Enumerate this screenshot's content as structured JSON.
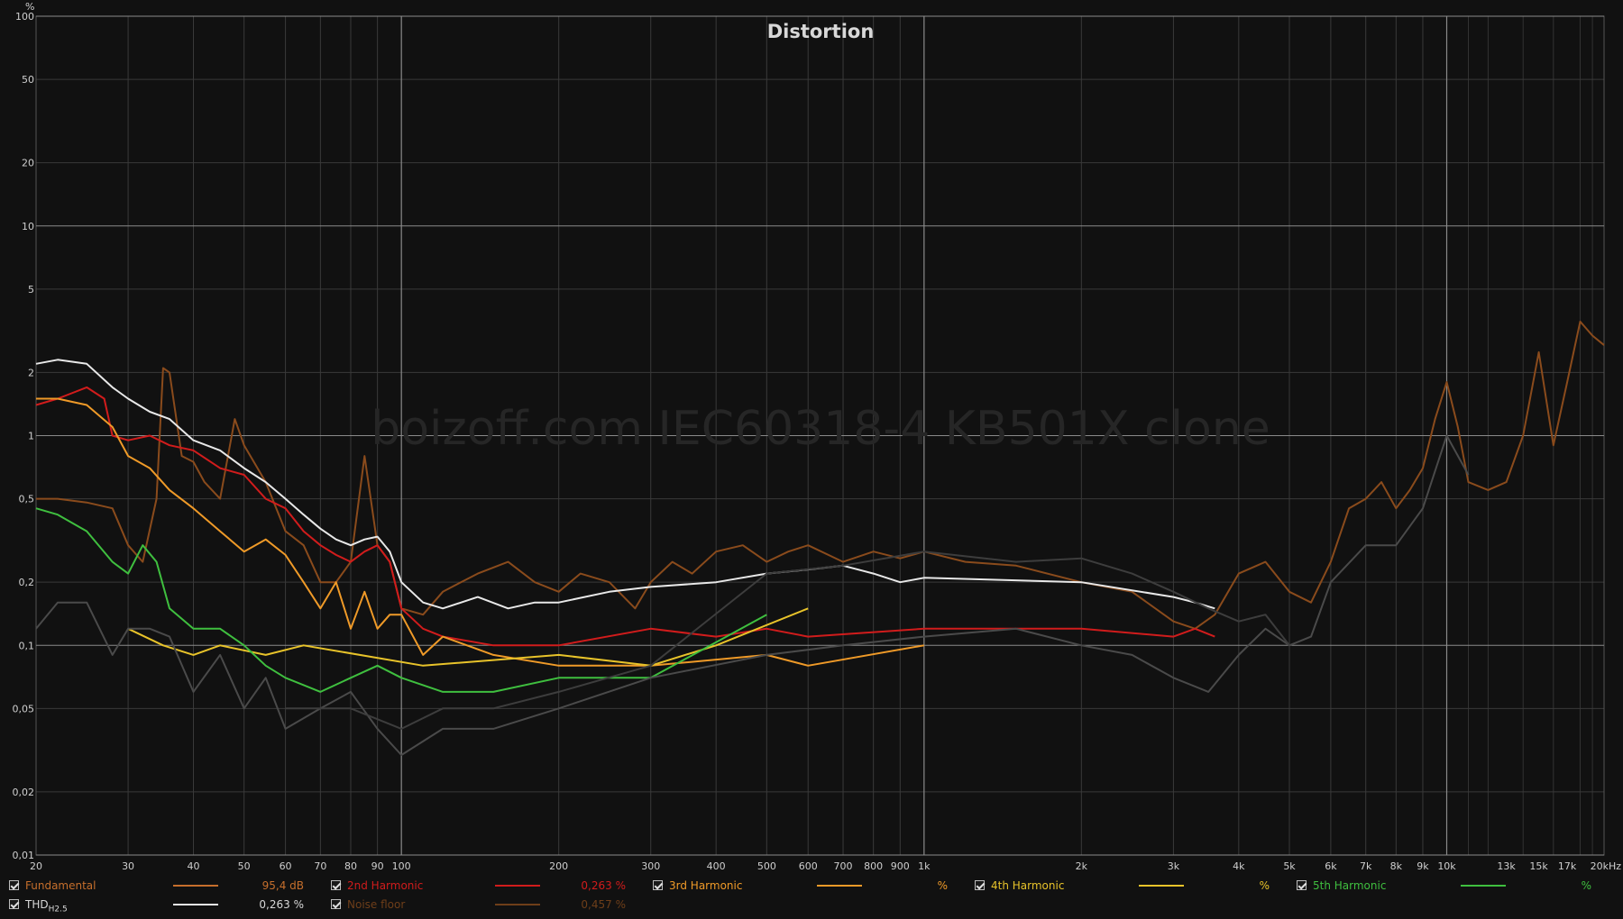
{
  "chart_data": {
    "type": "line",
    "title": "Distortion",
    "watermark": "boizoff.com IEC60318-4 KB501X clone",
    "y_unit": "%",
    "x_unit": "kHz",
    "xscale": "log",
    "yscale": "log",
    "xlim": [
      20,
      20000
    ],
    "ylim": [
      0.01,
      100
    ],
    "y_ticks": [
      100,
      50,
      20,
      10,
      5,
      2,
      1,
      0.5,
      0.2,
      0.1,
      0.05,
      0.02,
      0.01
    ],
    "y_tick_labels": [
      "100",
      "50",
      "20",
      "10",
      "5",
      "2",
      "1",
      "0,5",
      "0,2",
      "0,1",
      "0,05",
      "0,02",
      "0,01"
    ],
    "x_ticks": [
      20,
      30,
      40,
      50,
      60,
      70,
      80,
      90,
      100,
      200,
      300,
      400,
      500,
      600,
      700,
      800,
      900,
      1000,
      2000,
      3000,
      4000,
      5000,
      6000,
      7000,
      8000,
      9000,
      10000,
      13000,
      15000,
      17000,
      20000
    ],
    "x_tick_labels": [
      "20",
      "30",
      "40",
      "50",
      "60",
      "70",
      "80",
      "90",
      "100",
      "200",
      "300",
      "400",
      "500",
      "600",
      "700",
      "800",
      "900",
      "1k",
      "2k",
      "3k",
      "4k",
      "5k",
      "6k",
      "7k",
      "8k",
      "9k",
      "10k",
      "13k",
      "15k",
      "17k",
      "20kHz"
    ],
    "grid": true,
    "series": [
      {
        "key": "noise",
        "color": "#8a4b1c",
        "x": [
          20,
          22,
          25,
          28,
          30,
          32,
          34,
          35,
          36,
          38,
          40,
          42,
          45,
          48,
          50,
          55,
          60,
          65,
          70,
          75,
          80,
          85,
          90,
          95,
          100,
          110,
          120,
          130,
          140,
          160,
          180,
          200,
          220,
          250,
          280,
          300,
          330,
          360,
          400,
          450,
          500,
          550,
          600,
          700,
          800,
          900,
          1000,
          1200,
          1500,
          2000,
          2500,
          3000,
          3300,
          3600,
          4000,
          4500,
          5000,
          5500,
          6000,
          6500,
          7000,
          7500,
          8000,
          8500,
          9000,
          9500,
          10000,
          10500,
          11000,
          12000,
          13000,
          14000,
          15000,
          16000,
          17000,
          18000,
          19000,
          20000
        ],
        "y": [
          0.5,
          0.5,
          0.48,
          0.45,
          0.3,
          0.25,
          0.5,
          2.1,
          2.0,
          0.8,
          0.75,
          0.6,
          0.5,
          1.2,
          0.9,
          0.6,
          0.35,
          0.3,
          0.2,
          0.2,
          0.25,
          0.8,
          0.3,
          0.25,
          0.15,
          0.14,
          0.18,
          0.2,
          0.22,
          0.25,
          0.2,
          0.18,
          0.22,
          0.2,
          0.15,
          0.2,
          0.25,
          0.22,
          0.28,
          0.3,
          0.25,
          0.28,
          0.3,
          0.25,
          0.28,
          0.26,
          0.28,
          0.25,
          0.24,
          0.2,
          0.18,
          0.13,
          0.12,
          0.14,
          0.22,
          0.25,
          0.18,
          0.16,
          0.25,
          0.45,
          0.5,
          0.6,
          0.45,
          0.55,
          0.7,
          1.2,
          1.8,
          1.1,
          0.6,
          0.55,
          0.6,
          1.0,
          2.5,
          0.9,
          1.8,
          3.5,
          3.0,
          2.7
        ]
      },
      {
        "key": "fund",
        "color": "#c66f2c",
        "x": [],
        "y": []
      },
      {
        "key": "thd",
        "color": "#e8e8e8",
        "x": [
          20,
          22,
          25,
          28,
          30,
          33,
          36,
          40,
          45,
          50,
          55,
          60,
          65,
          70,
          75,
          80,
          85,
          90,
          95,
          100,
          110,
          120,
          140,
          160,
          180,
          200,
          250,
          300,
          400,
          500,
          600,
          700,
          800,
          900,
          1000,
          2000,
          3000,
          3300,
          3600
        ],
        "y": [
          2.2,
          2.3,
          2.2,
          1.7,
          1.5,
          1.3,
          1.2,
          0.95,
          0.85,
          0.7,
          0.6,
          0.5,
          0.42,
          0.36,
          0.32,
          0.3,
          0.32,
          0.33,
          0.28,
          0.2,
          0.16,
          0.15,
          0.17,
          0.15,
          0.16,
          0.16,
          0.18,
          0.19,
          0.2,
          0.22,
          0.23,
          0.24,
          0.22,
          0.2,
          0.21,
          0.2,
          0.17,
          0.16,
          0.15
        ]
      },
      {
        "key": "h2",
        "color": "#d11c1c",
        "x": [
          20,
          22,
          25,
          27,
          28,
          30,
          33,
          36,
          40,
          45,
          50,
          55,
          60,
          65,
          70,
          75,
          80,
          85,
          90,
          95,
          100,
          110,
          120,
          150,
          200,
          300,
          400,
          500,
          600,
          1000,
          2000,
          3000,
          3300,
          3600
        ],
        "y": [
          1.4,
          1.5,
          1.7,
          1.5,
          1.0,
          0.95,
          1.0,
          0.9,
          0.85,
          0.7,
          0.65,
          0.5,
          0.45,
          0.35,
          0.3,
          0.27,
          0.25,
          0.28,
          0.3,
          0.25,
          0.15,
          0.12,
          0.11,
          0.1,
          0.1,
          0.12,
          0.11,
          0.12,
          0.11,
          0.12,
          0.12,
          0.11,
          0.12,
          0.11
        ]
      },
      {
        "key": "h3",
        "color": "#ef9a28",
        "x": [
          20,
          22,
          25,
          28,
          30,
          33,
          36,
          40,
          45,
          50,
          55,
          60,
          65,
          70,
          75,
          80,
          85,
          90,
          95,
          100,
          110,
          120,
          150,
          200,
          300,
          500,
          600,
          1000
        ],
        "y": [
          1.5,
          1.5,
          1.4,
          1.1,
          0.8,
          0.7,
          0.55,
          0.45,
          0.35,
          0.28,
          0.32,
          0.27,
          0.2,
          0.15,
          0.2,
          0.12,
          0.18,
          0.12,
          0.14,
          0.14,
          0.09,
          0.11,
          0.09,
          0.08,
          0.08,
          0.09,
          0.08,
          0.1
        ]
      },
      {
        "key": "h4",
        "color": "#e8c32a",
        "x": [
          30,
          35,
          40,
          45,
          55,
          65,
          110,
          200,
          300,
          400,
          600
        ],
        "y": [
          0.12,
          0.1,
          0.09,
          0.1,
          0.09,
          0.1,
          0.08,
          0.09,
          0.08,
          0.1,
          0.15
        ]
      },
      {
        "key": "h5",
        "color": "#3fbf3f",
        "x": [
          20,
          22,
          25,
          28,
          30,
          32,
          34,
          36,
          40,
          45,
          50,
          55,
          60,
          70,
          80,
          90,
          100,
          120,
          150,
          200,
          300,
          500
        ],
        "y": [
          0.45,
          0.42,
          0.35,
          0.25,
          0.22,
          0.3,
          0.25,
          0.15,
          0.12,
          0.12,
          0.1,
          0.08,
          0.07,
          0.06,
          0.07,
          0.08,
          0.07,
          0.06,
          0.06,
          0.07,
          0.07,
          0.14
        ]
      },
      {
        "key": "grey1",
        "color": "#4a4a4a",
        "x": [
          20,
          22,
          25,
          28,
          30,
          33,
          36,
          40,
          45,
          50,
          55,
          60,
          70,
          80,
          90,
          100,
          120,
          150,
          200,
          300,
          500,
          700,
          1000,
          1500,
          2000,
          2500,
          3000,
          3500,
          4000,
          4500,
          5000,
          5500,
          6000,
          7000,
          8000,
          9000,
          10000,
          11000
        ],
        "y": [
          0.12,
          0.16,
          0.16,
          0.09,
          0.12,
          0.12,
          0.11,
          0.06,
          0.09,
          0.05,
          0.07,
          0.04,
          0.05,
          0.06,
          0.04,
          0.03,
          0.04,
          0.04,
          0.05,
          0.07,
          0.09,
          0.1,
          0.11,
          0.12,
          0.1,
          0.09,
          0.07,
          0.06,
          0.09,
          0.12,
          0.1,
          0.11,
          0.2,
          0.3,
          0.3,
          0.45,
          1.0,
          0.65
        ]
      },
      {
        "key": "grey2",
        "color": "#3d3d3d",
        "x": [
          60,
          80,
          100,
          120,
          150,
          200,
          300,
          500,
          700,
          1000,
          1500,
          2000,
          2500,
          3000,
          3500,
          4000,
          4500,
          5000
        ],
        "y": [
          0.05,
          0.05,
          0.04,
          0.05,
          0.05,
          0.06,
          0.08,
          0.22,
          0.24,
          0.28,
          0.25,
          0.26,
          0.22,
          0.18,
          0.15,
          0.13,
          0.14,
          0.1
        ]
      }
    ],
    "legend": {
      "placement": "bottom",
      "items": [
        {
          "label": "Fundamental",
          "value": "95,4 dB",
          "color": "#c66f2c",
          "label_color": "#c66f2c",
          "checked": true
        },
        {
          "label": "2nd Harmonic",
          "value": "0,263 %",
          "color": "#d11c1c",
          "label_color": "#d11c1c",
          "checked": true
        },
        {
          "label": "3rd Harmonic",
          "value": "%",
          "color": "#ef9a28",
          "label_color": "#ef9a28",
          "checked": true
        },
        {
          "label": "4th Harmonic",
          "value": "%",
          "color": "#e8c32a",
          "label_color": "#e8c32a",
          "checked": true
        },
        {
          "label": "5th Harmonic",
          "value": "%",
          "color": "#3fbf3f",
          "label_color": "#3fbf3f",
          "checked": true
        },
        {
          "label": "THD",
          "label_sub": "H2.5",
          "value": "0,263 %",
          "color": "#e8e8e8",
          "label_color": "#d8d8d8",
          "checked": true
        },
        {
          "label": "Noise floor",
          "value": "0,457 %",
          "color": "#6e3e19",
          "label_color": "#6e3e19",
          "checked": true
        }
      ]
    }
  }
}
